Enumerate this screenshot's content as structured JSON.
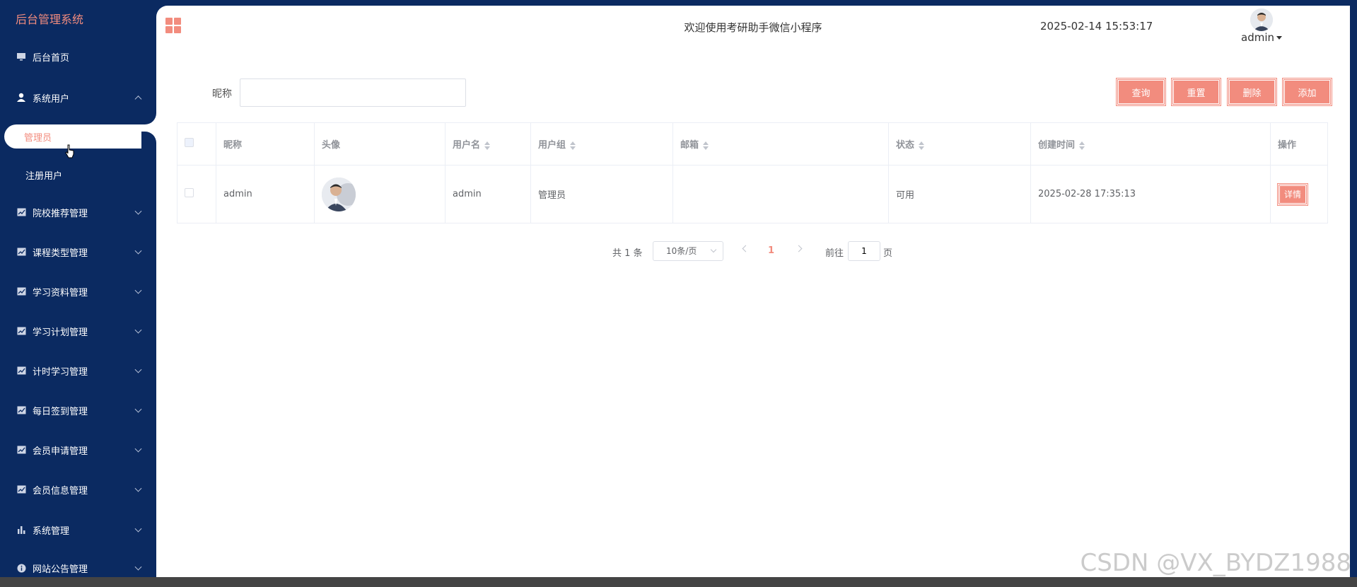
{
  "app": {
    "title": "后台管理系统"
  },
  "sidebar": {
    "items": [
      {
        "label": "后台首页",
        "icon": "monitor-icon"
      },
      {
        "label": "系统用户",
        "icon": "user-icon",
        "expanded": true,
        "children": [
          {
            "label": "管理员",
            "active": true
          },
          {
            "label": "注册用户"
          }
        ]
      },
      {
        "label": "院校推荐管理",
        "icon": "chart-icon"
      },
      {
        "label": "课程类型管理",
        "icon": "chart-icon"
      },
      {
        "label": "学习资料管理",
        "icon": "chart-icon"
      },
      {
        "label": "学习计划管理",
        "icon": "chart-icon"
      },
      {
        "label": "计时学习管理",
        "icon": "chart-icon"
      },
      {
        "label": "每日签到管理",
        "icon": "chart-icon"
      },
      {
        "label": "会员申请管理",
        "icon": "chart-icon"
      },
      {
        "label": "会员信息管理",
        "icon": "chart-icon"
      },
      {
        "label": "系统管理",
        "icon": "bar-chart-icon"
      },
      {
        "label": "网站公告管理",
        "icon": "info-icon"
      }
    ]
  },
  "header": {
    "title": "欢迎使用考研助手微信小程序",
    "time": "2025-02-14 15:53:17",
    "user": "admin"
  },
  "search": {
    "label": "昵称",
    "value": "",
    "placeholder": ""
  },
  "toolbar": {
    "query": "查询",
    "reset": "重置",
    "delete": "删除",
    "add": "添加"
  },
  "table": {
    "columns": [
      "昵称",
      "头像",
      "用户名",
      "用户组",
      "邮箱",
      "状态",
      "创建时间",
      "操作"
    ],
    "rows": [
      {
        "nickname": "admin",
        "username": "admin",
        "group": "管理员",
        "email": "",
        "status": "可用",
        "created": "2025-02-28 17:35:13",
        "action": "详情"
      }
    ]
  },
  "pagination": {
    "total": "共 1 条",
    "page_size": "10条/页",
    "current": "1",
    "goto_label": "前往",
    "goto_value": "1",
    "page_unit": "页"
  },
  "watermark": "CSDN @VX_BYDZ1988",
  "colors": {
    "sidebar": "#0b2a61",
    "accent": "#f28c7e"
  }
}
